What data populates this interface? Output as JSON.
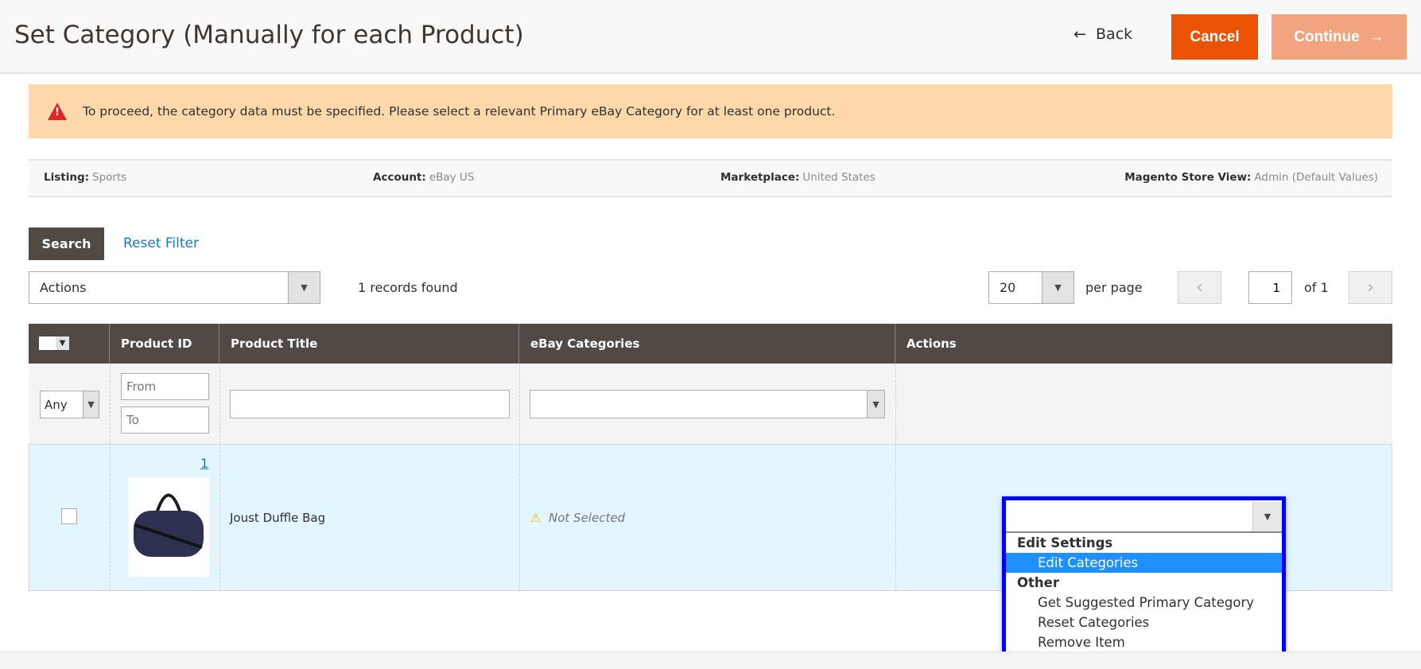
{
  "header": {
    "title": "Set Category (Manually for each Product)",
    "back_label": "Back",
    "cancel_label": "Cancel",
    "continue_label": "Continue"
  },
  "warning": {
    "text": "To proceed, the category data must be specified. Please select a relevant Primary eBay Category for at least one product."
  },
  "info": [
    {
      "label": "Listing:",
      "value": "Sports"
    },
    {
      "label": "Account:",
      "value": "eBay US"
    },
    {
      "label": "Marketplace:",
      "value": "United States"
    },
    {
      "label": "Magento Store View:",
      "value": "Admin (Default Values)"
    }
  ],
  "toolbar": {
    "search_label": "Search",
    "reset_label": "Reset Filter",
    "actions_value": "Actions",
    "records": "1 records found",
    "per_page_value": "20",
    "per_page_label": "per page",
    "page": "1",
    "of_pages": "of 1"
  },
  "table": {
    "columns": [
      "Product ID",
      "Product Title",
      "eBay Categories",
      "Actions"
    ],
    "filters": {
      "any": "Any",
      "from_placeholder": "From",
      "to_placeholder": "To"
    },
    "rows": [
      {
        "id": "1",
        "title": "Joust Duffle Bag",
        "category": "Not Selected"
      }
    ]
  },
  "action_dropdown": {
    "groups": [
      {
        "label": "Edit Settings",
        "options": [
          "Edit Categories"
        ]
      },
      {
        "label": "Other",
        "options": [
          "Get Suggested Primary Category",
          "Reset Categories",
          "Remove Item"
        ]
      }
    ],
    "highlighted": "Edit Categories"
  },
  "colors": {
    "primary": "#eb5202",
    "header_bg": "#514943",
    "row_bg": "#e3f5fd",
    "highlight": "#1e90ff"
  }
}
